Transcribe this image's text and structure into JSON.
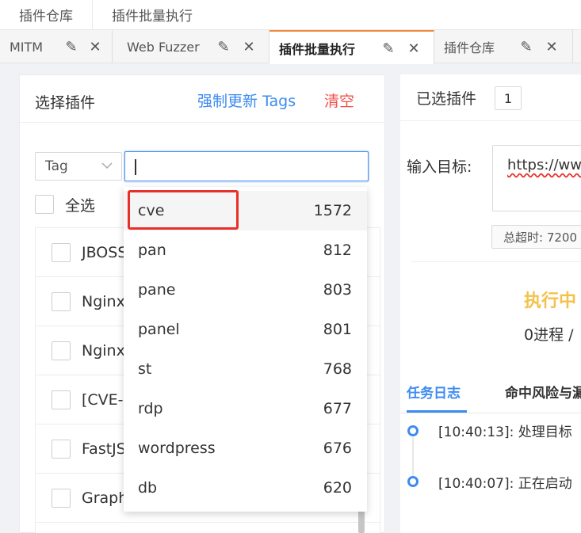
{
  "topbar": {
    "tabs": [
      "插件仓库",
      "插件批量执行"
    ]
  },
  "tabs": [
    {
      "label": "MITM"
    },
    {
      "label": "Web Fuzzer"
    },
    {
      "label": "插件批量执行",
      "active": true
    },
    {
      "label": "插件仓库"
    }
  ],
  "left": {
    "title": "选择插件",
    "force_update": "强制更新 Tags",
    "clear": "清空",
    "tag_select": "Tag",
    "check_all": "全选",
    "plugins": [
      "JBOSS",
      "Nginx",
      "Nginx",
      "[CVE-",
      "FastJS",
      "Graph"
    ]
  },
  "dropdown": {
    "options": [
      {
        "tag": "cve",
        "count": "1572"
      },
      {
        "tag": "pan",
        "count": "812"
      },
      {
        "tag": "pane",
        "count": "803"
      },
      {
        "tag": "panel",
        "count": "801"
      },
      {
        "tag": "st",
        "count": "768"
      },
      {
        "tag": "rdp",
        "count": "677"
      },
      {
        "tag": "wordpress",
        "count": "676"
      },
      {
        "tag": "db",
        "count": "620"
      }
    ]
  },
  "right": {
    "selected_label": "已选插件",
    "selected_count": "1",
    "target_label": "输入目标:",
    "target_value": "https://ww",
    "timeout": "总超时: 7200",
    "running": "执行中",
    "progress": "0进程 /",
    "tab_log": "任务日志",
    "tab_risk": "命中风险与漏",
    "logs": [
      {
        "text": "[10:40:13]: 处理目标"
      },
      {
        "text": "[10:40:07]: 正在启动"
      }
    ]
  },
  "colors": {
    "accent": "#3e8bf0",
    "danger": "#f0524d",
    "highlight": "#e8302a",
    "running": "#f3c24a",
    "tab_active": "#f28b3c"
  }
}
